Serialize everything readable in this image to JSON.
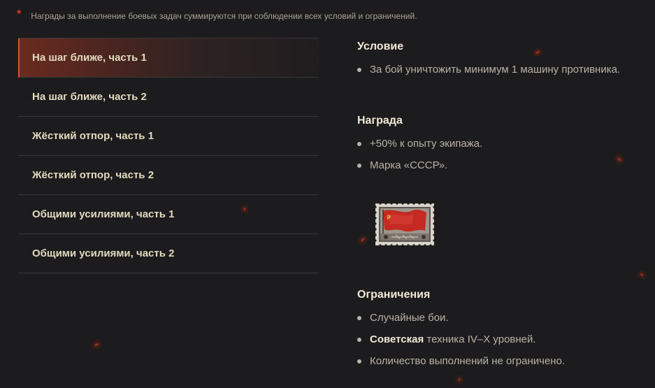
{
  "note": {
    "asterisk": "*",
    "text": "Награды за выполнение боевых задач суммируются при соблюдении всех условий и ограничений."
  },
  "missions": [
    {
      "label": "На шаг ближе, часть 1",
      "active": true
    },
    {
      "label": "На шаг ближе, часть 2",
      "active": false
    },
    {
      "label": "Жёсткий отпор, часть 1",
      "active": false
    },
    {
      "label": "Жёсткий отпор, часть 2",
      "active": false
    },
    {
      "label": "Общими усилиями, часть 1",
      "active": false
    },
    {
      "label": "Общими усилиями, часть 2",
      "active": false
    }
  ],
  "condition": {
    "title": "Условие",
    "items": [
      "За бой уничтожить минимум 1 машину противника."
    ]
  },
  "reward": {
    "title": "Награда",
    "items": [
      "+50% к опыту экипажа.",
      "Марка «СССР»."
    ],
    "stamp_icon": "ussr-flag-stamp-icon"
  },
  "limits": {
    "title": "Ограничения",
    "item1": "Случайные бои.",
    "item2_bold": "Советская",
    "item2_rest": " техника IV–X уровней.",
    "item3": "Количество выполнений не ограничено."
  },
  "colors": {
    "background": "#1c1b1d",
    "accent": "#e0502b",
    "title": "#f1ead6",
    "text": "#b9b4a7"
  }
}
